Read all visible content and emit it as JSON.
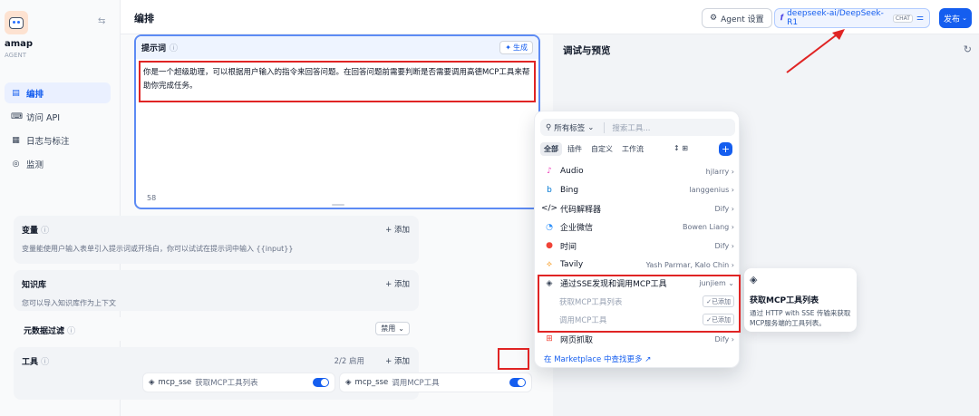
{
  "app": {
    "name": "amap",
    "type": "AGENT"
  },
  "sidebar": {
    "items": [
      {
        "label": "编排",
        "icon": "layout-icon"
      },
      {
        "label": "访问 API",
        "icon": "terminal-icon"
      },
      {
        "label": "日志与标注",
        "icon": "log-icon"
      },
      {
        "label": "监测",
        "icon": "monitor-icon"
      }
    ]
  },
  "header": {
    "title": "编排",
    "agent_settings": "Agent 设置",
    "model_name": "deepseek-ai/DeepSeek-R1",
    "model_badge": "CHAT",
    "publish": "发布"
  },
  "prompt": {
    "title": "提示词",
    "generate": "生成",
    "text": "你是一个超级助理，可以根据用户输入的指令来回答问题。在回答问题前需要判断是否需要调用高德MCP工具来帮助你完成任务。",
    "count": "58"
  },
  "variables": {
    "title": "变量",
    "add": "+ 添加",
    "desc": "变量能使用户输入表单引入提示词或开场白，你可以试试在提示词中输入 {{input}}"
  },
  "knowledge": {
    "title": "知识库",
    "add": "+ 添加",
    "desc": "您可以导入知识库作为上下文"
  },
  "metadata": {
    "title": "元数据过滤",
    "value": "禁用"
  },
  "tools": {
    "title": "工具",
    "status": "2/2 启用",
    "add": "+ 添加",
    "items": [
      {
        "provider": "mcp_sse",
        "name": "获取MCP工具列表"
      },
      {
        "provider": "mcp_sse",
        "name": "调用MCP工具"
      }
    ]
  },
  "debug": {
    "title": "调试与预览"
  },
  "picker": {
    "tags": "所有标签",
    "search_placeholder": "搜索工具...",
    "tabs": [
      "全部",
      "插件",
      "自定义",
      "工作流"
    ],
    "tools": [
      {
        "name": "Audio",
        "author": "hjlarry",
        "icon": "audio-icon",
        "color": "#ee46bc"
      },
      {
        "name": "Bing",
        "author": "langgenius",
        "icon": "bing-icon",
        "color": "#0078d4"
      },
      {
        "name": "代码解释器",
        "author": "Dify",
        "icon": "code-icon",
        "color": "#101828"
      },
      {
        "name": "企业微信",
        "author": "Bowen Liang",
        "icon": "wecom-icon",
        "color": "#2e90fa"
      },
      {
        "name": "时间",
        "author": "Dify",
        "icon": "clock-icon",
        "color": "#f04438"
      },
      {
        "name": "Tavily",
        "author": "Yash Parmar, Kalo Chin",
        "icon": "tavily-icon",
        "color": "#f79009"
      },
      {
        "name": "通过SSE发现和调用MCP工具",
        "author": "junjiem",
        "icon": "mcp-icon",
        "color": "#344054"
      }
    ],
    "subtools": [
      {
        "name": "获取MCP工具列表",
        "status": "已添加"
      },
      {
        "name": "调用MCP工具",
        "status": "已添加"
      }
    ],
    "last_tool": {
      "name": "网页抓取",
      "author": "Dify",
      "icon": "spider-icon",
      "color": "#f04438"
    },
    "marketplace": "在 Marketplace 中查找更多 ↗"
  },
  "tooltip": {
    "title": "获取MCP工具列表",
    "desc": "通过 HTTP with SSE 传输来获取MCP服务端的工具列表。"
  }
}
